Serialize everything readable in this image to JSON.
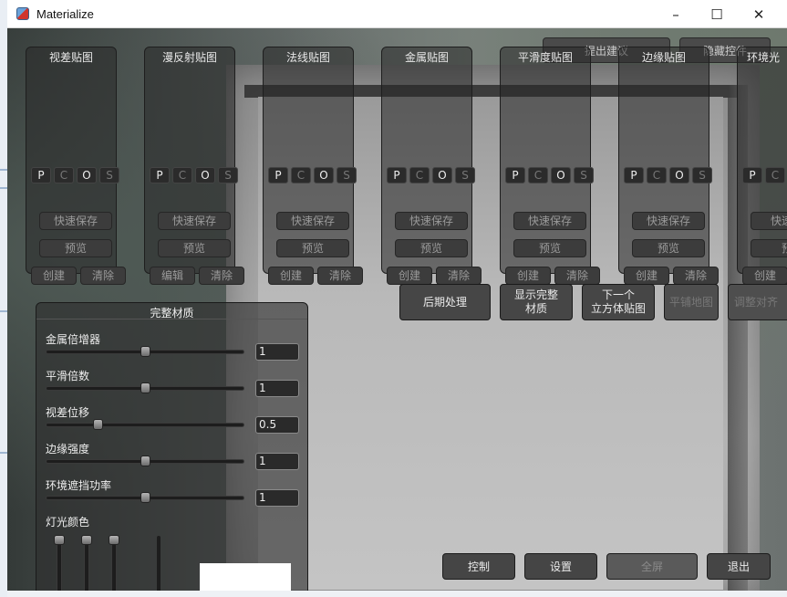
{
  "window": {
    "title": "Materialize",
    "minimize": "–",
    "maximize": "☐",
    "close": "✕"
  },
  "top_buttons": {
    "suggest": "提出建议",
    "hide_controls": "隐藏控件"
  },
  "pcos": [
    "P",
    "C",
    "O",
    "S"
  ],
  "panels": [
    {
      "title": "视差贴图",
      "quick_save": "快速保存",
      "preview": "预览",
      "left": "创建",
      "right": "清除"
    },
    {
      "title": "漫反射贴图",
      "quick_save": "快速保存",
      "preview": "预览",
      "left": "编辑",
      "right": "清除"
    },
    {
      "title": "法线贴图",
      "quick_save": "快速保存",
      "preview": "预览",
      "left": "创建",
      "right": "清除"
    },
    {
      "title": "金属贴图",
      "quick_save": "快速保存",
      "preview": "预览",
      "left": "创建",
      "right": "清除"
    },
    {
      "title": "平滑度贴图",
      "quick_save": "快速保存",
      "preview": "预览",
      "left": "创建",
      "right": "清除"
    },
    {
      "title": "边缘贴图",
      "quick_save": "快速保存",
      "preview": "预览",
      "left": "创建",
      "right": "清除"
    },
    {
      "title": "环境光",
      "quick_save": "快速保",
      "preview": "预",
      "left": "创建",
      "right": ""
    }
  ],
  "actions": {
    "post_process": "后期处理",
    "show_full_material_l1": "显示完整",
    "show_full_material_l2": "材质",
    "next_cubemap_l1": "下一个",
    "next_cubemap_l2": "立方体贴图",
    "tile_map": "平铺地图",
    "adjust_align": "调整对齐"
  },
  "full_material": {
    "title": "完整材质",
    "sliders": [
      {
        "label": "金属倍增器",
        "value": "1",
        "level": 0.5
      },
      {
        "label": "平滑倍数",
        "value": "1",
        "level": 0.5
      },
      {
        "label": "视差位移",
        "value": "0.5",
        "level": 0.25
      },
      {
        "label": "边缘强度",
        "value": "1",
        "level": 0.5
      },
      {
        "label": "环境遮挡功率",
        "value": "1",
        "level": 0.5
      }
    ],
    "light_color_label": "灯光颜色",
    "light_color": "#ffffff"
  },
  "bottom_buttons": {
    "control": "控制",
    "settings": "设置",
    "fullscreen": "全屏",
    "exit": "退出"
  }
}
